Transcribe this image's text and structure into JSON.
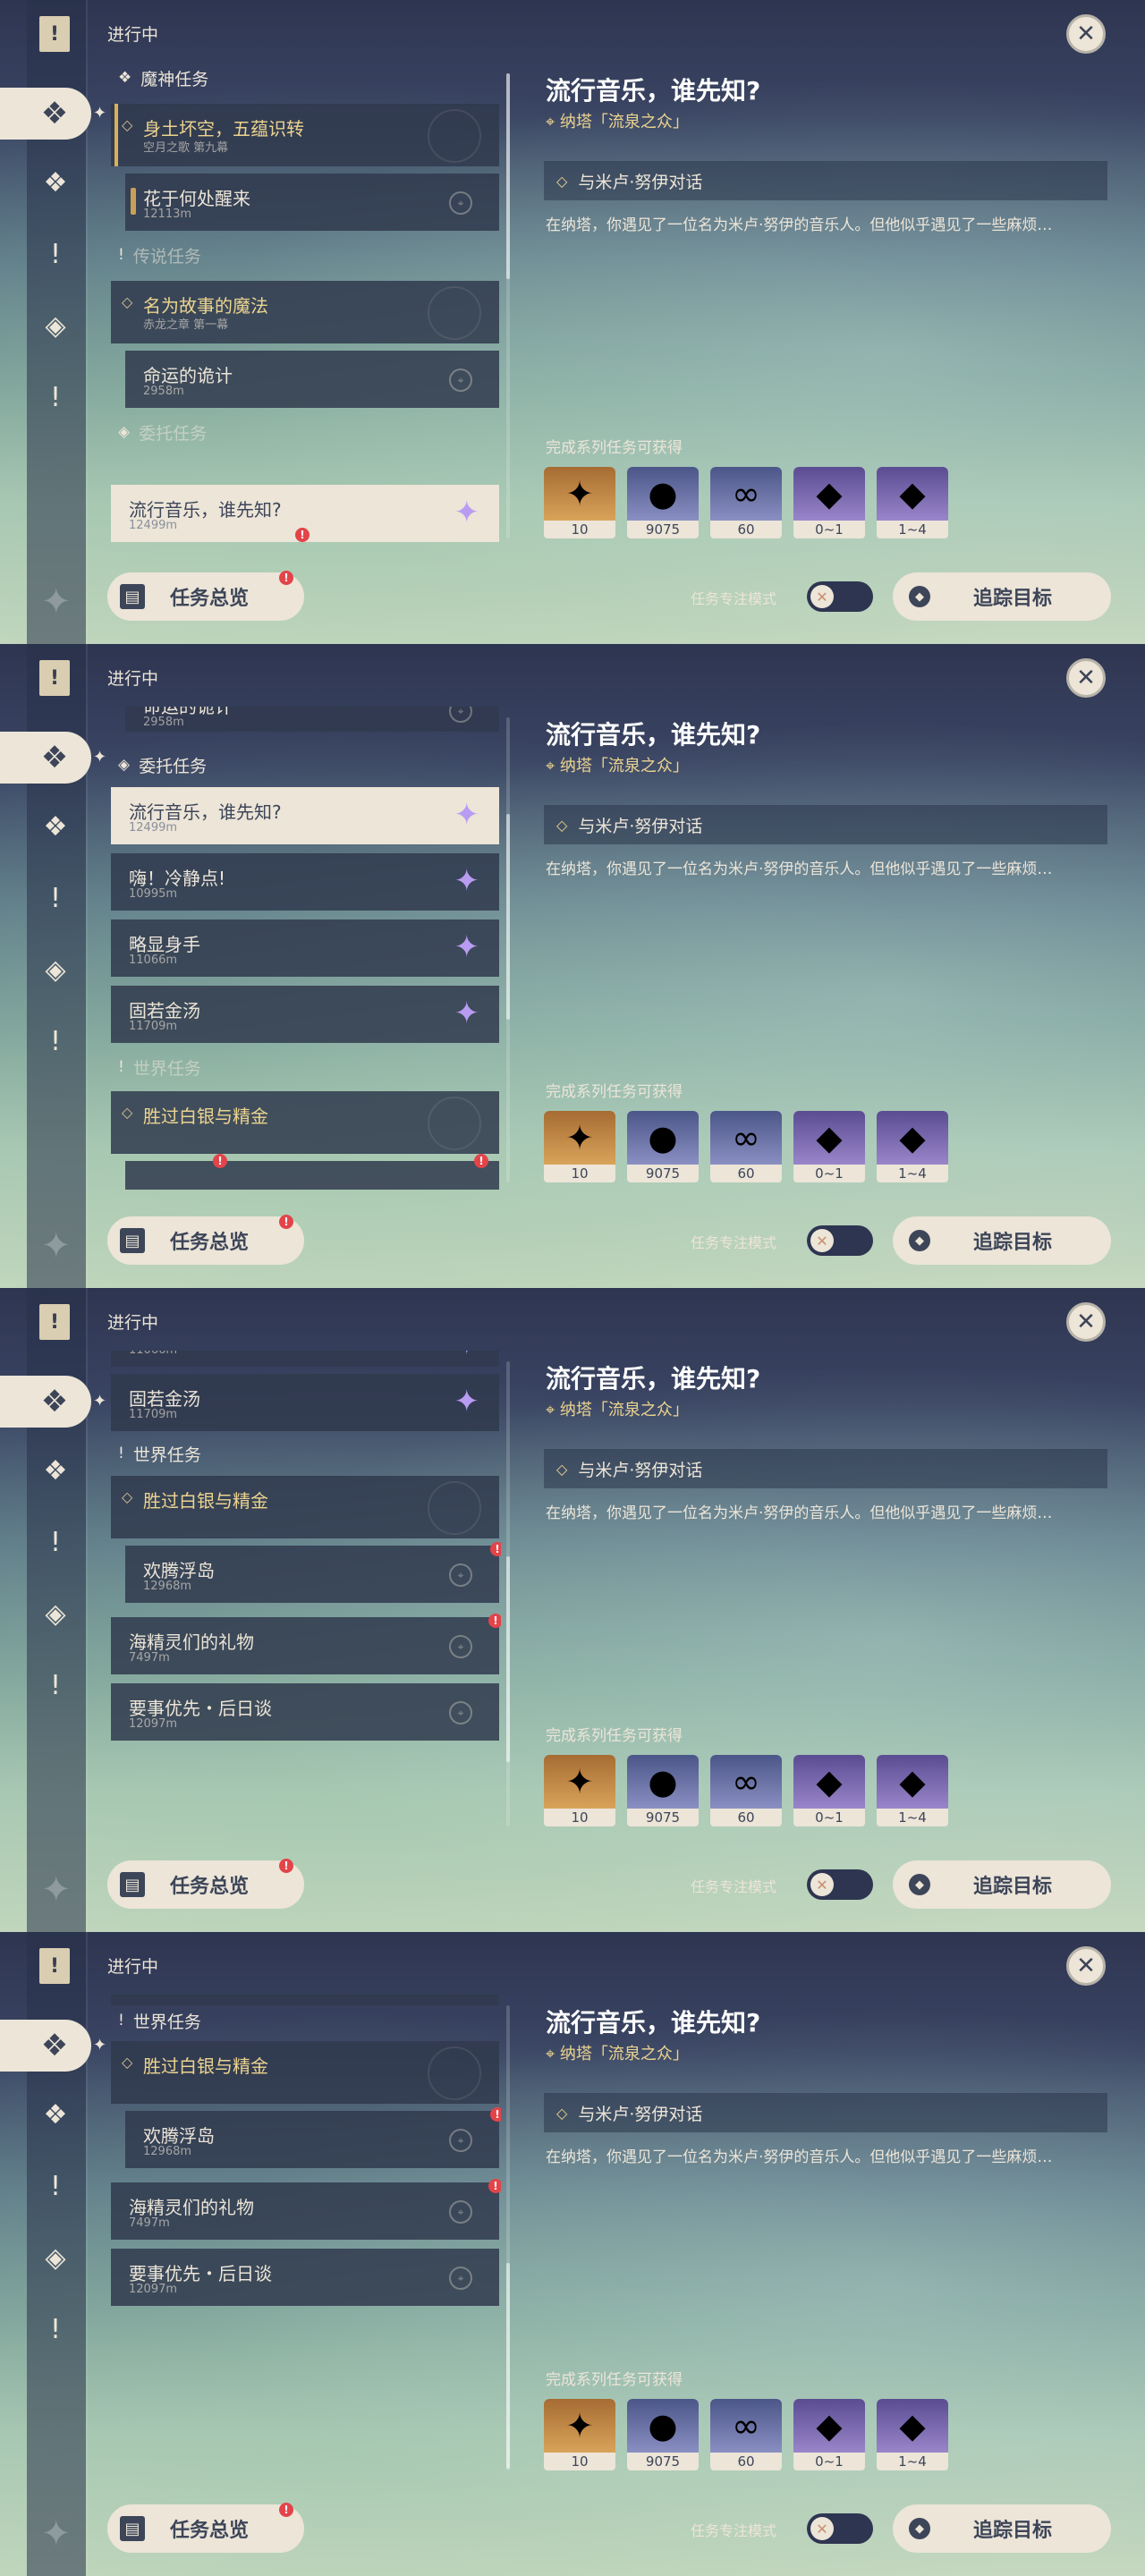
{
  "header": {
    "progress_title": "进行中",
    "close_icon": "✕"
  },
  "quest": {
    "title": "流行音乐，谁先知?",
    "location": "纳塔「流泉之众」",
    "objective": "与米卢·努伊对话",
    "description": "在纳塔，你遇见了一位名为米卢·努伊的音乐人。但他似乎遇见了一些麻烦…",
    "rewards_label": "完成系列任务可获得",
    "rewards": [
      {
        "icon": "primogem-icon",
        "count": "10",
        "rarity": "gold"
      },
      {
        "icon": "mora-icon",
        "count": "9075",
        "rarity": "blue"
      },
      {
        "icon": "exp-icon",
        "count": "60",
        "rarity": "blue"
      },
      {
        "icon": "crystal-icon",
        "count": "0~1",
        "rarity": "purple"
      },
      {
        "icon": "crystal-cluster-icon",
        "count": "1~4",
        "rarity": "purple"
      }
    ]
  },
  "footer": {
    "overview_label": "任务总览",
    "focus_label": "任务专注模式",
    "track_label": "追踪目标"
  },
  "categories": {
    "archon": "魔神任务",
    "story": "传说任务",
    "commission": "委托任务",
    "world": "世界任务"
  },
  "quests": {
    "q1": {
      "title": "身土坏空，五蕴识转",
      "sub": "空月之歌 第九幕"
    },
    "q2": {
      "title": "花于何处醒来",
      "sub": "12113m"
    },
    "q3": {
      "title": "名为故事的魔法",
      "sub": "赤龙之章 第一幕"
    },
    "q4": {
      "title": "命运的诡计",
      "sub": "2958m"
    },
    "q5": {
      "title": "流行音乐，谁先知?",
      "sub": "12499m"
    },
    "q6": {
      "title": "嗨！冷静点!",
      "sub": "10995m"
    },
    "q7": {
      "title": "略显身手",
      "sub": "11066m"
    },
    "q8": {
      "title": "固若金汤",
      "sub": "11709m"
    },
    "q9": {
      "title": "胜过白银与精金",
      "sub": ""
    },
    "q10": {
      "title": "欢腾浮岛",
      "sub": "12968m"
    },
    "q11": {
      "title": "海精灵们的礼物",
      "sub": "7497m"
    },
    "q12": {
      "title": "要事优先・后日谈",
      "sub": "12097m"
    }
  }
}
